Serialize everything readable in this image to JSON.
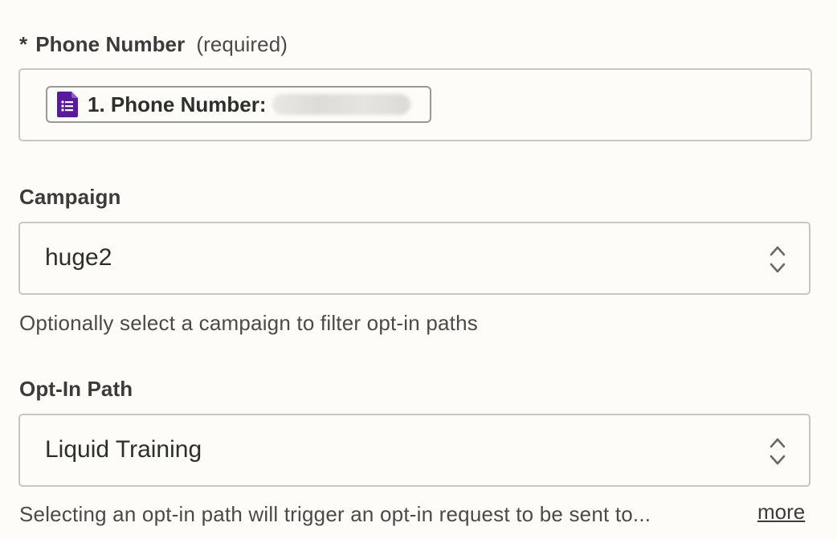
{
  "phone": {
    "asterisk": "*",
    "label": "Phone Number",
    "required": "(required)",
    "pill": {
      "icon": "google-forms-icon",
      "text": "1. Phone Number:"
    }
  },
  "campaign": {
    "label": "Campaign",
    "value": "huge2",
    "help": "Optionally select a campaign to filter opt-in paths"
  },
  "optin": {
    "label": "Opt-In Path",
    "value": "Liquid Training",
    "help": "Selecting an opt-in path will trigger an opt-in request to be sent to...",
    "more": "more"
  },
  "colors": {
    "background": "#fdfcf8",
    "border": "#c9c6c0",
    "forms_icon": "#5b1a9b",
    "text": "#2d2e2e"
  }
}
